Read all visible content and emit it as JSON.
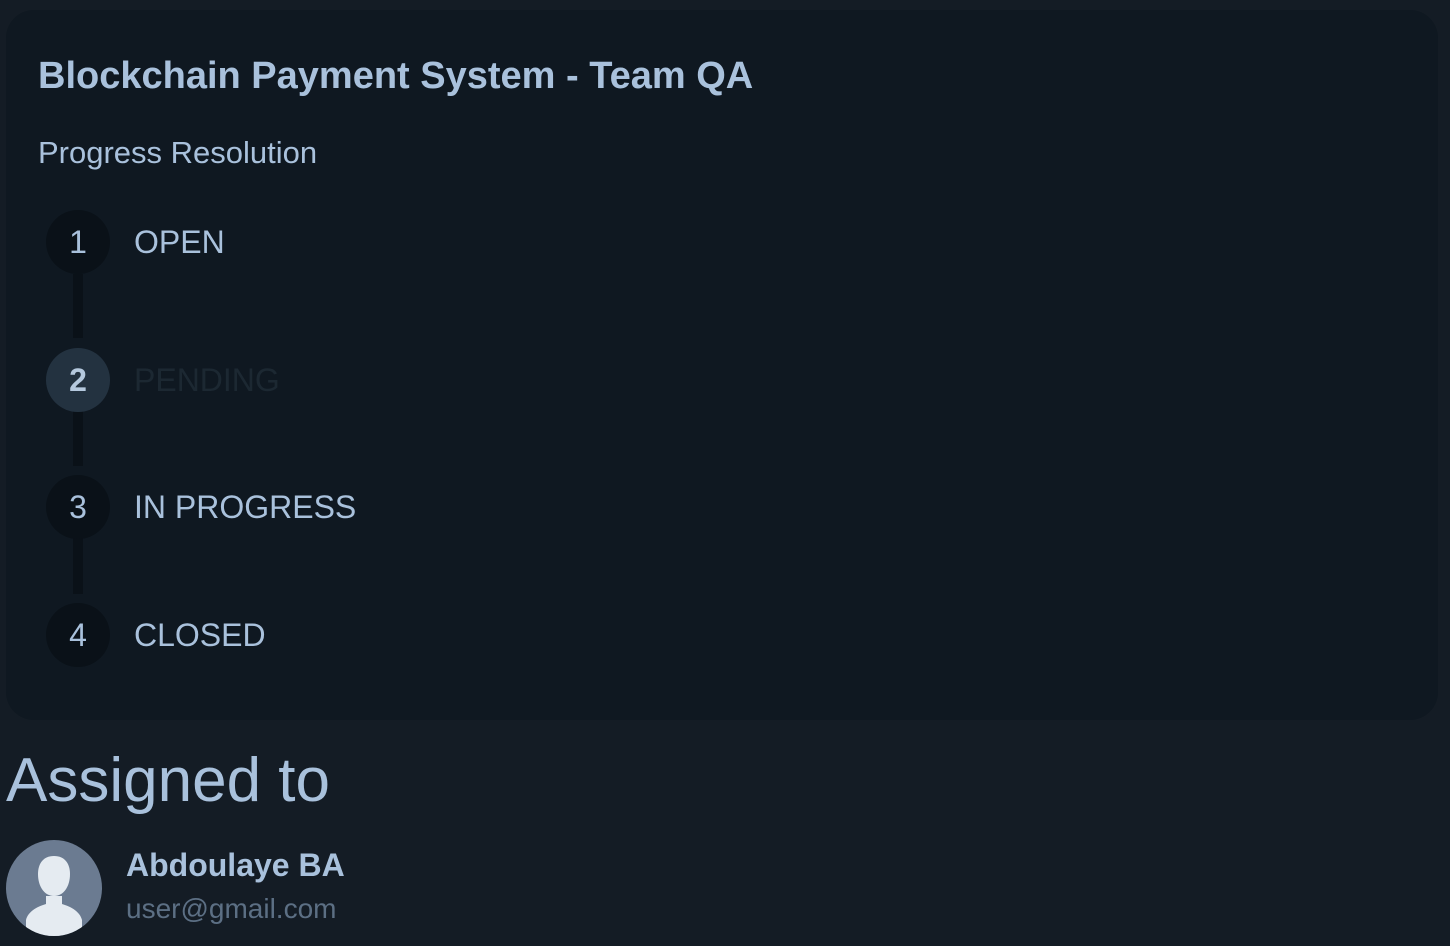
{
  "ticket": {
    "title": "Blockchain Payment System - Team QA"
  },
  "progress": {
    "label": "Progress Resolution",
    "current_step": 2,
    "steps": [
      {
        "number": "1",
        "label": "OPEN"
      },
      {
        "number": "2",
        "label": "PENDING"
      },
      {
        "number": "3",
        "label": "IN PROGRESS"
      },
      {
        "number": "4",
        "label": "CLOSED"
      }
    ]
  },
  "assigned": {
    "heading": "Assigned to",
    "name": "Abdoulaye BA",
    "email": "user@gmail.com",
    "avatar_icon": "default-user-avatar-icon"
  },
  "colors": {
    "page_background": "#141c25",
    "card_background": "#0f1821",
    "text_primary": "#a9c1dc",
    "text_muted": "#5c6f84",
    "active_step_circle": "#233240",
    "avatar_background": "#6b7b91"
  }
}
